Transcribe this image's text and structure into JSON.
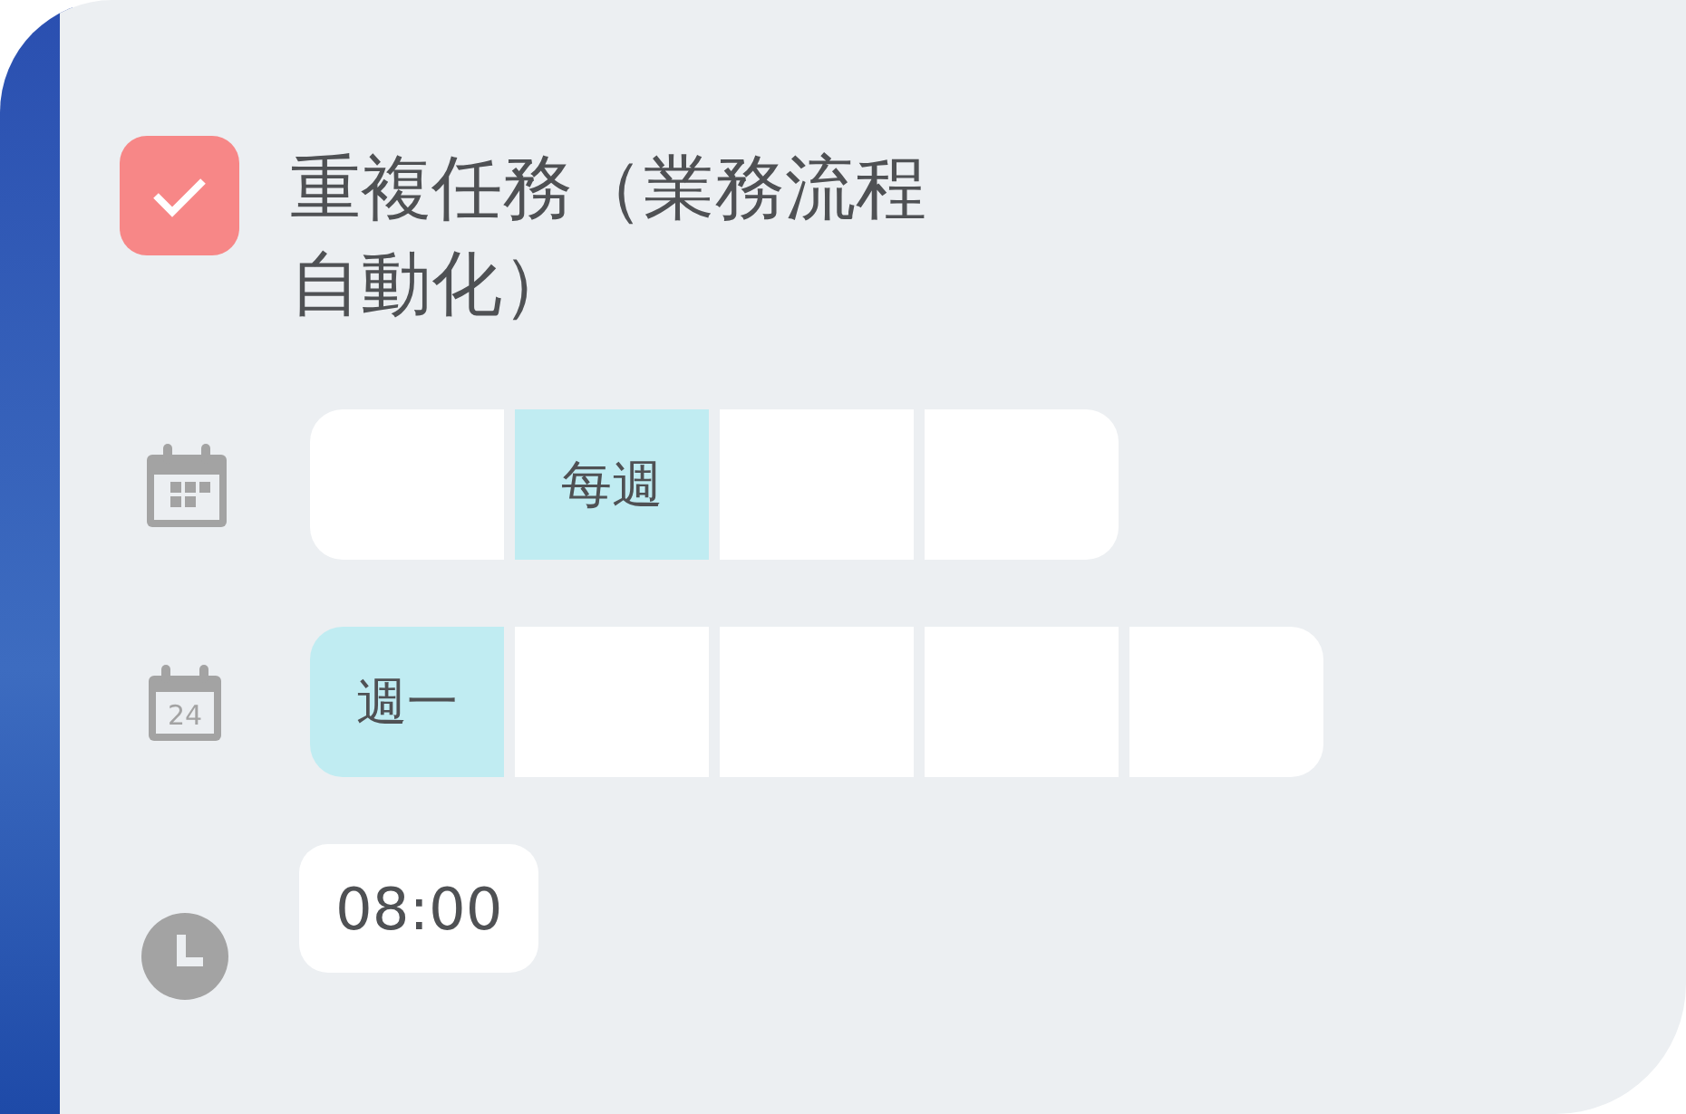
{
  "task": {
    "checked": true,
    "title": "重複任務（業務流程自動化）"
  },
  "frequency": {
    "segments": [
      {
        "selected": false
      },
      {
        "label": "每週",
        "selected": true
      },
      {
        "selected": false
      },
      {
        "selected": false
      }
    ]
  },
  "weekday": {
    "icon_text": "24",
    "segments": [
      {
        "label": "週一",
        "selected": true
      },
      {
        "selected": false
      },
      {
        "selected": false
      },
      {
        "selected": false
      },
      {
        "selected": false
      }
    ]
  },
  "time": {
    "value": "08:00"
  }
}
